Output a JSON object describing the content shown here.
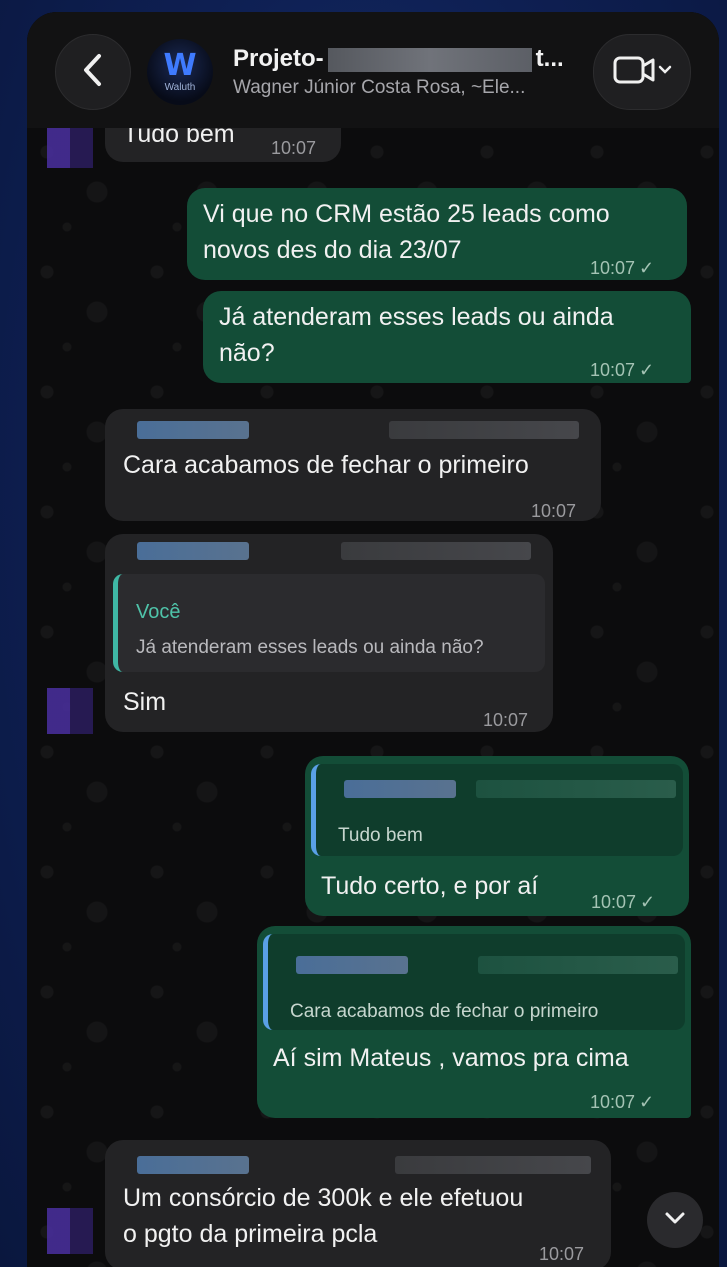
{
  "header": {
    "title_prefix": "Projeto-",
    "title_suffix": "t...",
    "subtitle": "Wagner Júnior Costa Rosa, ~Ele...",
    "avatar_brand": "Waluth",
    "avatar_letter": "W"
  },
  "messages": [
    {
      "dir": "in",
      "text": "Tudo bem",
      "time": "10:07"
    },
    {
      "dir": "out",
      "lines": [
        "Vi que no CRM estão 25 leads como",
        "novos des do dia 23/07"
      ],
      "time": "10:07",
      "status": "✓"
    },
    {
      "dir": "out",
      "lines": [
        "Já atenderam esses leads ou ainda",
        "não?"
      ],
      "time": "10:07",
      "status": "✓"
    },
    {
      "dir": "in",
      "text": "Cara acabamos de fechar o primeiro",
      "time": "10:07"
    },
    {
      "dir": "in",
      "quote_author": "Você",
      "quote_text": "Já atenderam esses leads ou ainda não?",
      "text": "Sim",
      "time": "10:07"
    },
    {
      "dir": "out",
      "quote_text": "Tudo bem",
      "text": "Tudo certo, e por aí",
      "time": "10:07",
      "status": "✓"
    },
    {
      "dir": "out",
      "quote_text": "Cara acabamos de fechar o primeiro",
      "text": "Aí sim Mateus , vamos pra cima",
      "time": "10:07",
      "status": "✓"
    },
    {
      "dir": "in",
      "lines": [
        "Um consórcio de 300k e ele efetuou",
        "o pgto da primeira pcla"
      ],
      "time": "10:07"
    }
  ],
  "colors": {
    "incoming_bubble": "#232325",
    "outgoing_bubble": "#134d37",
    "quote_accent": "#3fb7a4"
  },
  "icons": {
    "back": "chevron-left-icon",
    "video": "video-camera-icon",
    "scroll_down": "chevron-down-icon"
  }
}
